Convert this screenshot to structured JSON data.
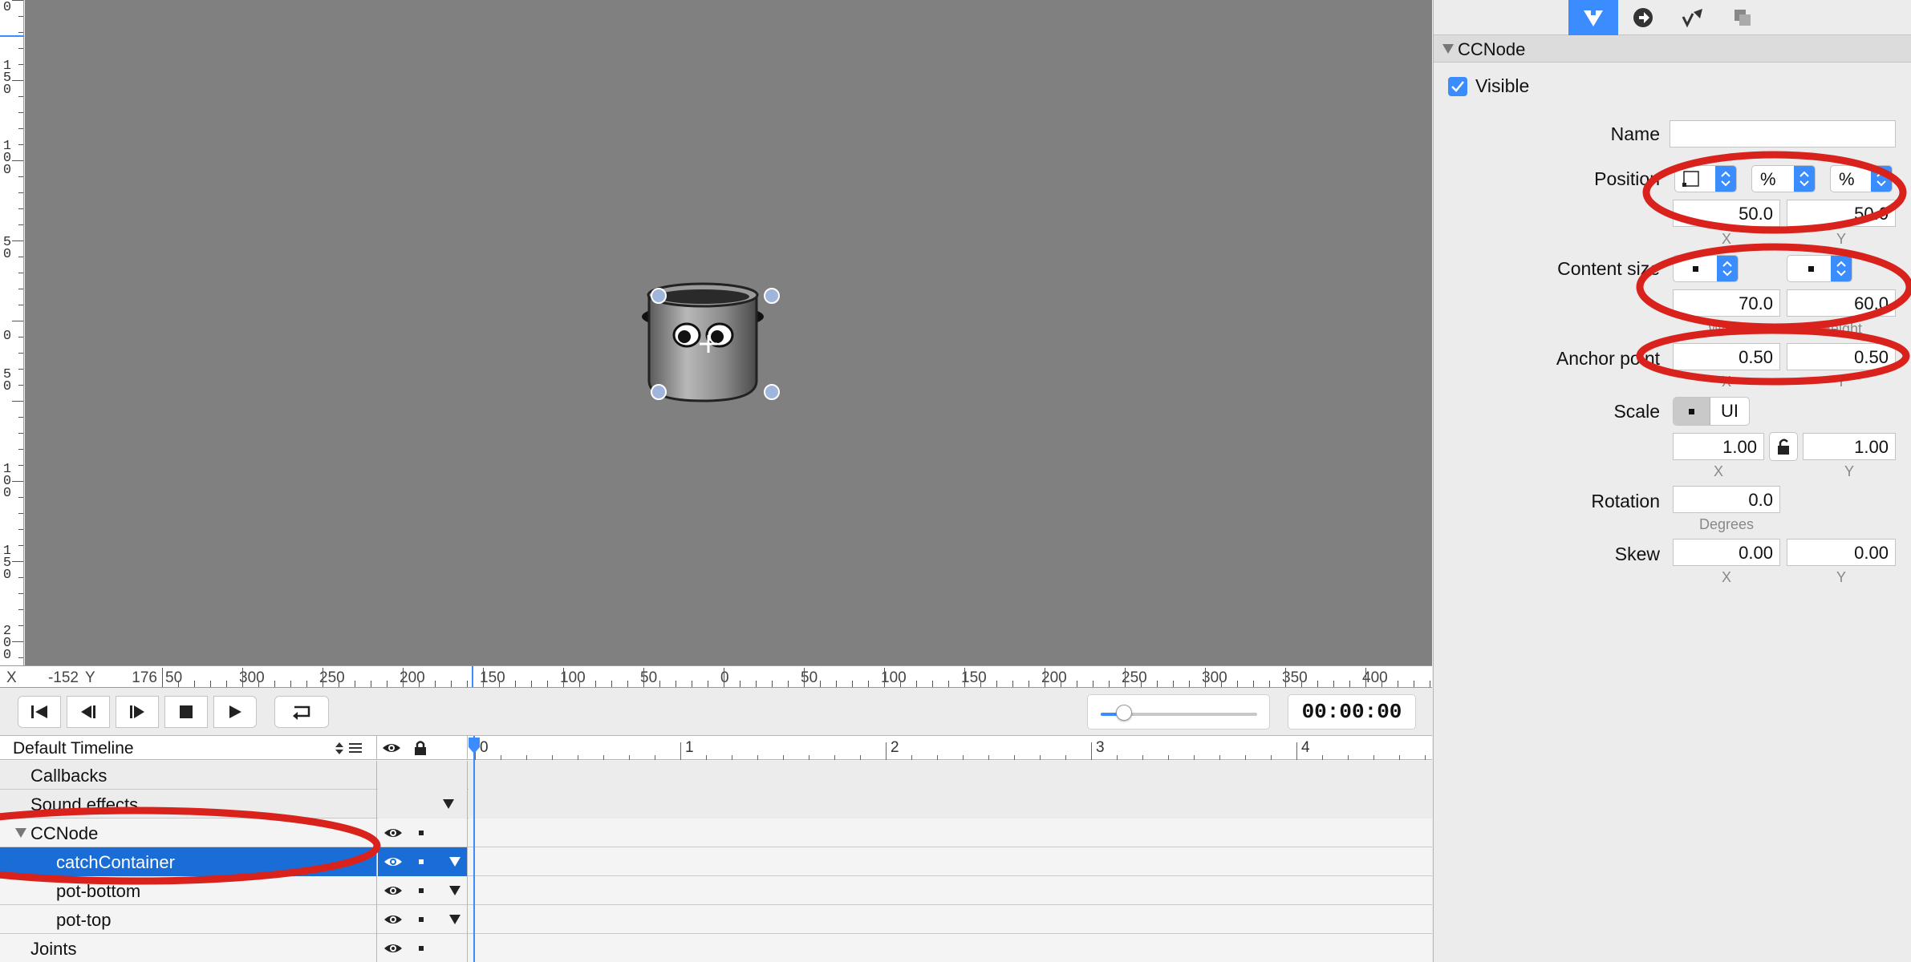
{
  "status": {
    "x_label": "X",
    "x_value": "-152",
    "y_label": "Y",
    "y_value": "176"
  },
  "vertical_ruler_labels": [
    "0",
    "1\n5\n0",
    "1\n0\n0",
    "5\n0",
    "0",
    "5\n0",
    "1\n0\n0",
    "1\n5\n0",
    "2\n0\n0"
  ],
  "horizontal_ruler_labels": [
    "50",
    "300",
    "250",
    "200",
    "150",
    "100",
    "50",
    "0",
    "50",
    "100",
    "150",
    "200",
    "250",
    "300",
    "350",
    "400"
  ],
  "transport": {
    "zoom_level": 0.15,
    "time": "00:00:00"
  },
  "timeline": {
    "name": "Default Timeline",
    "ruler": [
      "0",
      "1",
      "2",
      "3",
      "4"
    ],
    "rows": [
      {
        "label": "Callbacks"
      },
      {
        "label": "Sound effects"
      },
      {
        "label": "CCNode"
      },
      {
        "label": "catchContainer"
      },
      {
        "label": "pot-bottom"
      },
      {
        "label": "pot-top"
      },
      {
        "label": "Joints"
      }
    ]
  },
  "inspector": {
    "section_title": "CCNode",
    "visible_label": "Visible",
    "visible_checked": true,
    "name_label": "Name",
    "name_value": "",
    "position": {
      "label": "Position",
      "unit_x": "%",
      "unit_y": "%",
      "x": "50.0",
      "y": "50.0",
      "x_sub": "X",
      "y_sub": "Y"
    },
    "content_size": {
      "label": "Content size",
      "w": "70.0",
      "h": "60.0",
      "w_sub": "Width",
      "h_sub": "Height"
    },
    "anchor": {
      "label": "Anchor point",
      "x": "0.50",
      "y": "0.50",
      "x_sub": "X",
      "y_sub": "Y"
    },
    "scale": {
      "label": "Scale",
      "seg_ui": "UI",
      "x": "1.00",
      "y": "1.00",
      "x_sub": "X",
      "y_sub": "Y"
    },
    "rotation": {
      "label": "Rotation",
      "value": "0.0",
      "sub": "Degrees"
    },
    "skew": {
      "label": "Skew",
      "x": "0.00",
      "y": "0.00",
      "x_sub": "X",
      "y_sub": "Y"
    }
  },
  "colors": {
    "accent": "#3a8cff",
    "selection": "#1a6dd6",
    "annotation_red": "#d9221c",
    "stage_gray": "#808080"
  },
  "icons": [
    "go-to-start-icon",
    "step-back-icon",
    "play-reverse-icon",
    "stop-icon",
    "play-icon",
    "loop-icon",
    "eye-icon",
    "lock-icon",
    "node-properties-tab-icon",
    "code-connections-tab-icon",
    "physics-tab-icon",
    "templates-tab-icon"
  ]
}
